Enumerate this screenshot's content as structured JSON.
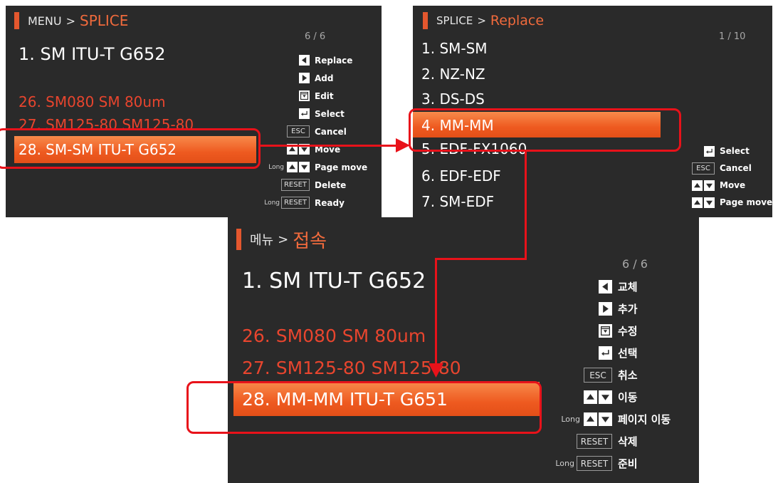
{
  "screen1": {
    "header": {
      "root": "MENU",
      "sep": ">",
      "current": "SPLICE"
    },
    "page": "6 / 6",
    "title": "1. SM ITU-T G652",
    "items": [
      "26. SM080 SM 80um",
      "27. SM125-80 SM125-80"
    ],
    "selected": "28. SM-SM ITU-T G652",
    "help": {
      "replace": "Replace",
      "add": "Add",
      "edit": "Edit",
      "select": "Select",
      "esc_key": "ESC",
      "cancel": "Cancel",
      "move": "Move",
      "long": "Long",
      "page_move": "Page move",
      "reset_key": "RESET",
      "delete": "Delete",
      "ready": "Ready"
    }
  },
  "screen2": {
    "header": {
      "root": "SPLICE",
      "sep": ">",
      "current": "Replace"
    },
    "page": "1 / 10",
    "items": [
      "1. SM-SM",
      "2. NZ-NZ",
      "3. DS-DS"
    ],
    "selected": "4. MM-MM",
    "items_after": [
      "5. EDF-FX1060",
      "6. EDF-EDF",
      "7. SM-EDF"
    ],
    "help": {
      "select": "Select",
      "esc_key": "ESC",
      "cancel": "Cancel",
      "move": "Move",
      "page_move": "Page move"
    }
  },
  "screen3": {
    "header": {
      "root": "메뉴",
      "sep": ">",
      "current": "접속"
    },
    "page": "6 / 6",
    "title": "1. SM ITU-T G652",
    "items": [
      "26. SM080 SM 80um",
      "27. SM125-80 SM125-80"
    ],
    "selected": "28. MM-MM ITU-T G651",
    "help": {
      "replace": "교체",
      "add": "추가",
      "edit": "수정",
      "select": "선택",
      "esc_key": "ESC",
      "cancel": "취소",
      "move": "이동",
      "long": "Long",
      "page_move": "페이지 이동",
      "reset_key": "RESET",
      "delete": "삭제",
      "ready": "준비"
    }
  },
  "colors": {
    "accent": "#f06a3c",
    "highlight": "#ee5a20",
    "annotation": "#e8121a",
    "background": "#2a2a2a"
  }
}
